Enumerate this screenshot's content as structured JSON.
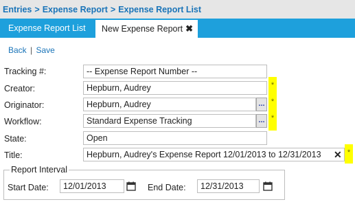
{
  "breadcrumb": {
    "items": [
      "Entries",
      "Expense Report",
      "Expense Report List"
    ],
    "separator": ">"
  },
  "tabs": [
    {
      "label": "Expense Report List",
      "active": false
    },
    {
      "label": "New Expense Report",
      "active": true,
      "close_icon": "close-icon"
    }
  ],
  "actions": {
    "back": "Back",
    "separator": "|",
    "save": "Save"
  },
  "form": {
    "tracking": {
      "label": "Tracking #:",
      "value": "-- Expense Report Number --"
    },
    "creator": {
      "label": "Creator:",
      "value": "Hepburn, Audrey"
    },
    "originator": {
      "label": "Originator:",
      "value": "Hepburn, Audrey",
      "lookup": "..."
    },
    "workflow": {
      "label": "Workflow:",
      "value": "Standard Expense Tracking",
      "lookup": "..."
    },
    "state": {
      "label": "State:",
      "value": "Open"
    },
    "title": {
      "label": "Title:",
      "value": "Hepburn, Audrey's Expense Report 12/01/2013 to 12/31/2013"
    },
    "required_marker": "*"
  },
  "report_interval": {
    "legend": "Report Interval",
    "start": {
      "label": "Start Date:",
      "value": "12/01/2013"
    },
    "end": {
      "label": "End Date:",
      "value": "12/31/2013"
    }
  },
  "colors": {
    "accent": "#1ea0dc",
    "link": "#1a74b8",
    "required": "#ffff00",
    "breadcrumb_bg": "#e6e6e6"
  }
}
